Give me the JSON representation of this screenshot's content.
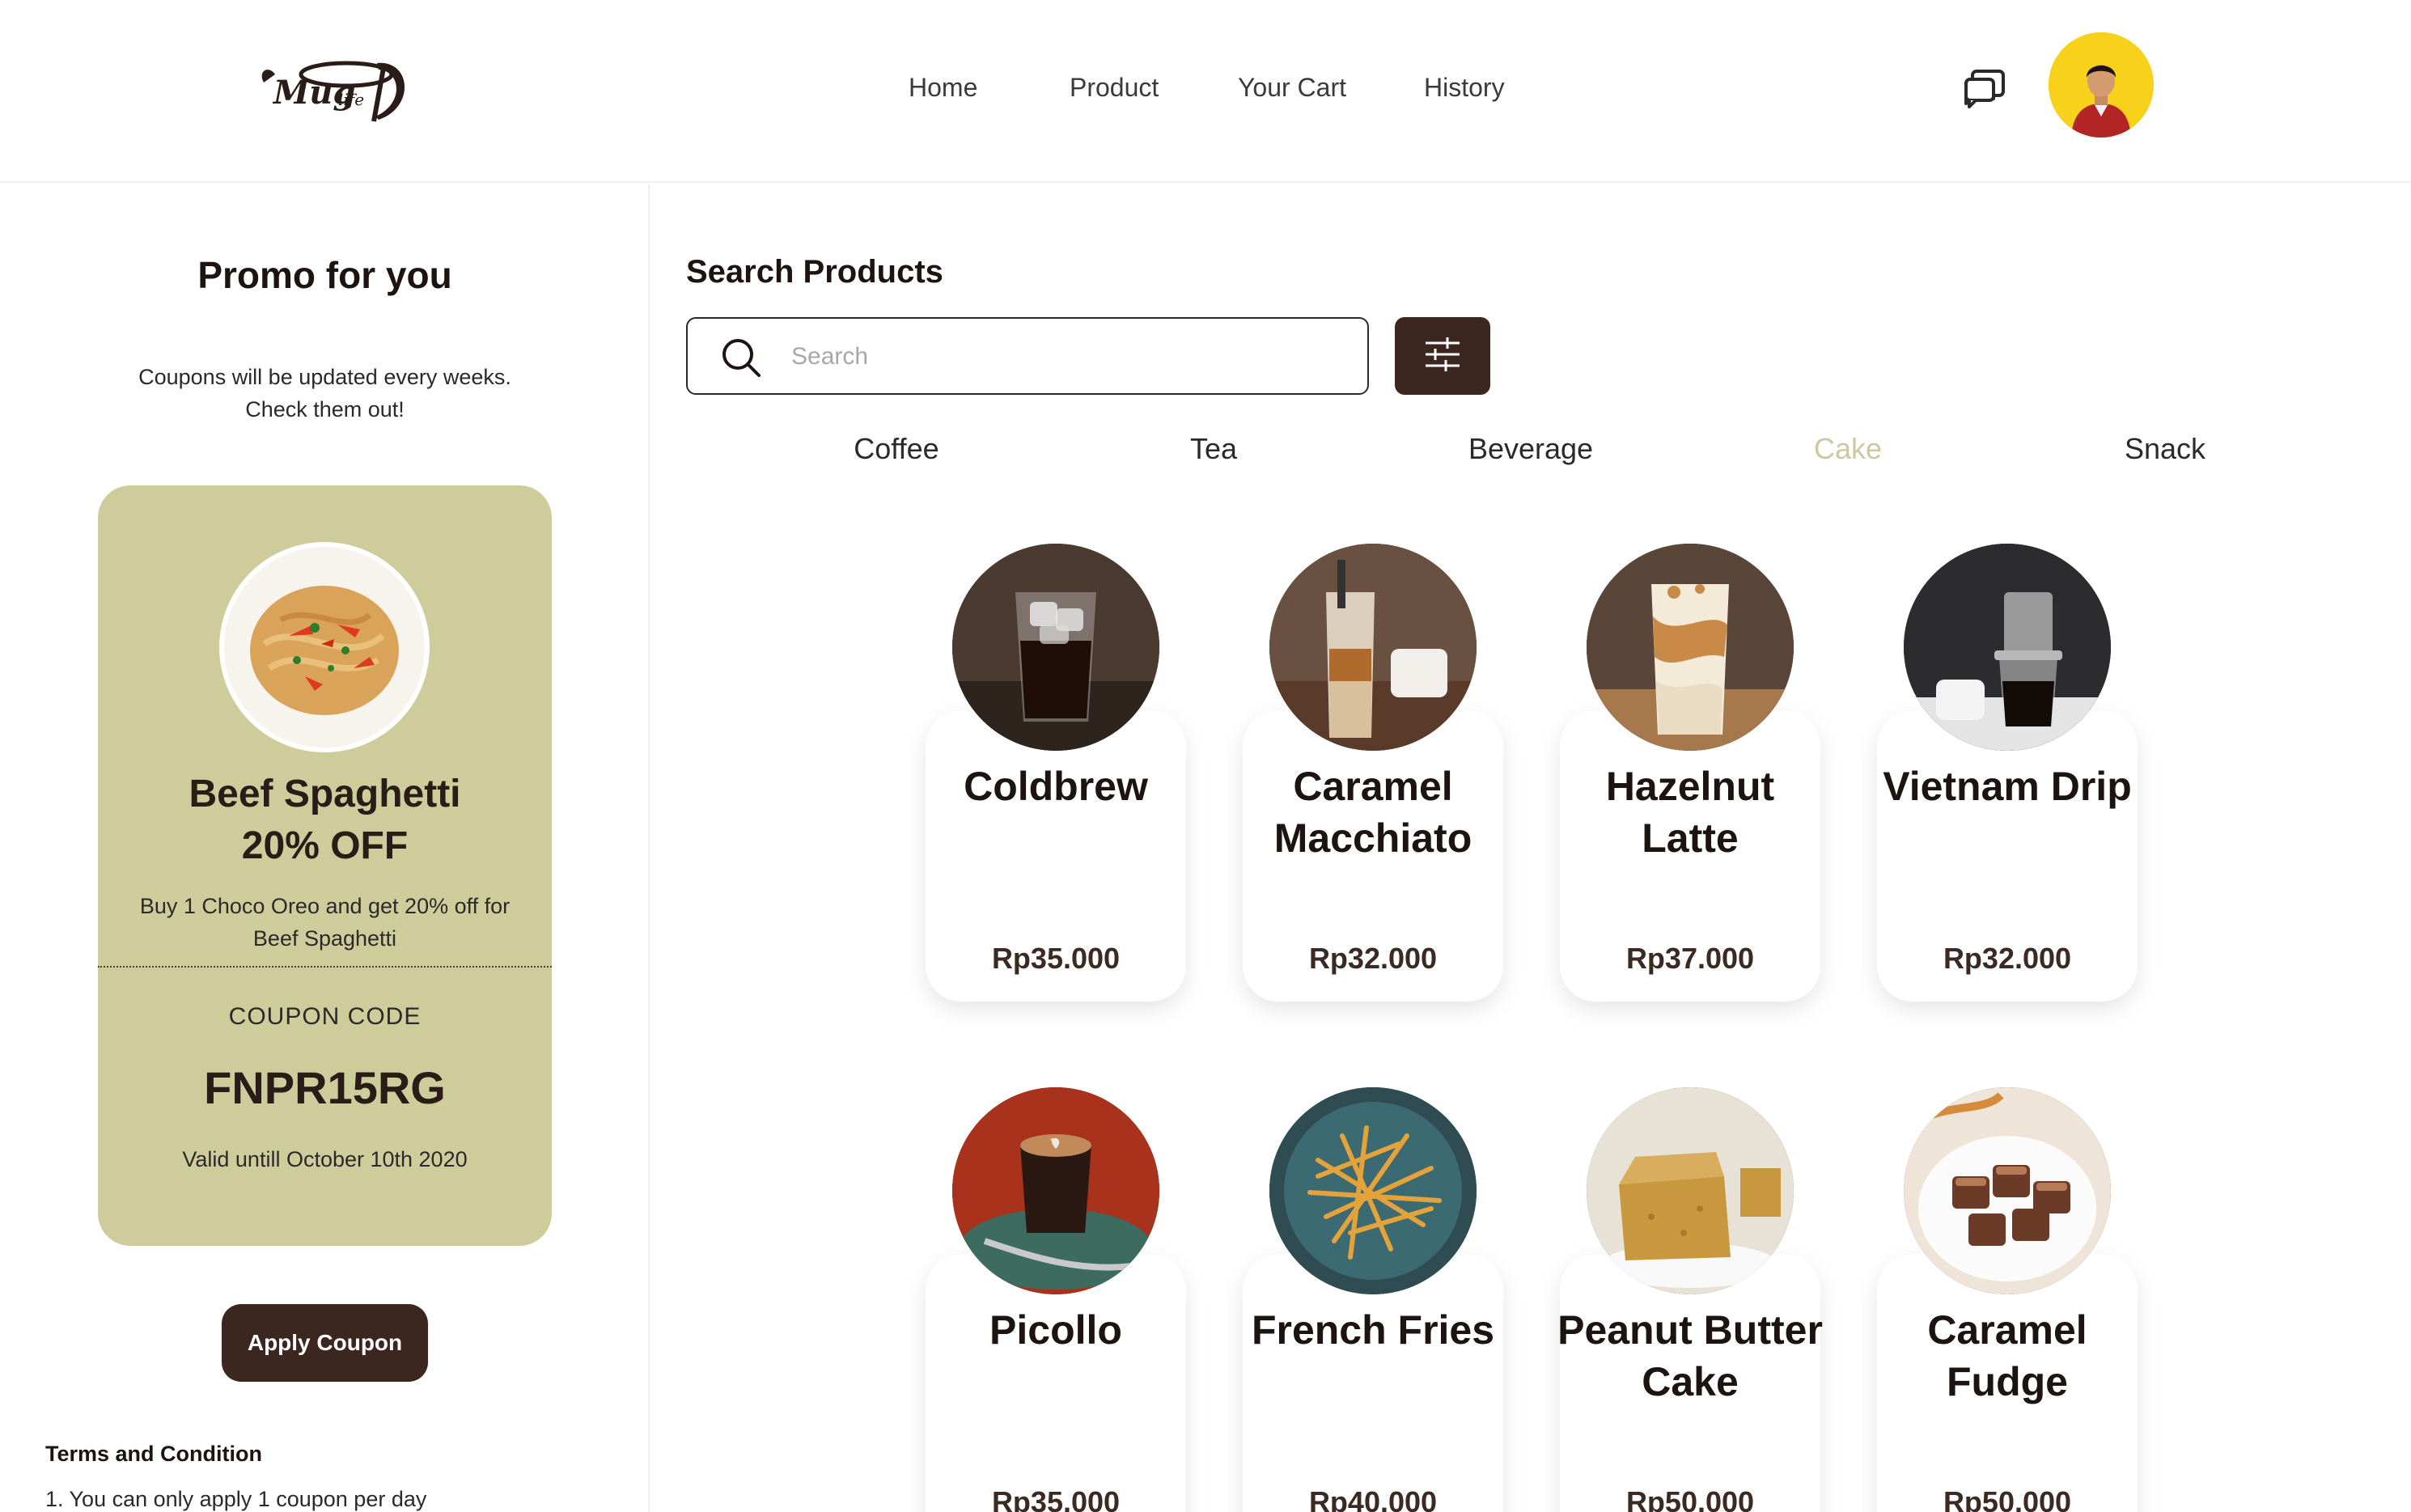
{
  "brand": {
    "logo_text": "Mug life",
    "colors": {
      "primary": "#3b2620",
      "coupon_bg": "#cfcc9c",
      "active_category": "#cdc7a2",
      "avatar_bg": "#f7d11a"
    }
  },
  "nav": {
    "items": [
      "Home",
      "Product",
      "Your Cart",
      "History"
    ],
    "chat_icon": "chat-bubbles-icon"
  },
  "promo": {
    "title": "Promo for you",
    "subtitle": "Coupons will be updated every weeks. Check them out!",
    "coupon": {
      "name_line1": "Beef Spaghetti",
      "name_line2": "20% OFF",
      "description": "Buy 1 Choco Oreo and get 20% off for Beef Spaghetti",
      "code_label": "COUPON CODE",
      "code": "FNPR15RG",
      "valid": "Valid untill October 10th 2020"
    },
    "apply_label": "Apply Coupon",
    "terms_title": "Terms and Condition",
    "terms": [
      "1. You can only apply 1 coupon per day"
    ]
  },
  "search": {
    "title": "Search Products",
    "placeholder": "Search",
    "value": ""
  },
  "categories": {
    "items": [
      "Coffee",
      "Tea",
      "Beverage",
      "Cake",
      "Snack"
    ],
    "active": "Cake"
  },
  "products": [
    {
      "name": "Coldbrew",
      "price": "Rp35.000"
    },
    {
      "name": "Caramel Macchiato",
      "price": "Rp32.000"
    },
    {
      "name": "Hazelnut Latte",
      "price": "Rp37.000"
    },
    {
      "name": "Vietnam Drip",
      "price": "Rp32.000"
    },
    {
      "name": "Picollo",
      "price": "Rp35.000"
    },
    {
      "name": "French Fries",
      "price": "Rp40.000"
    },
    {
      "name": "Peanut Butter Cake",
      "price": "Rp50.000"
    },
    {
      "name": "Caramel Fudge",
      "price": "Rp50.000"
    }
  ]
}
